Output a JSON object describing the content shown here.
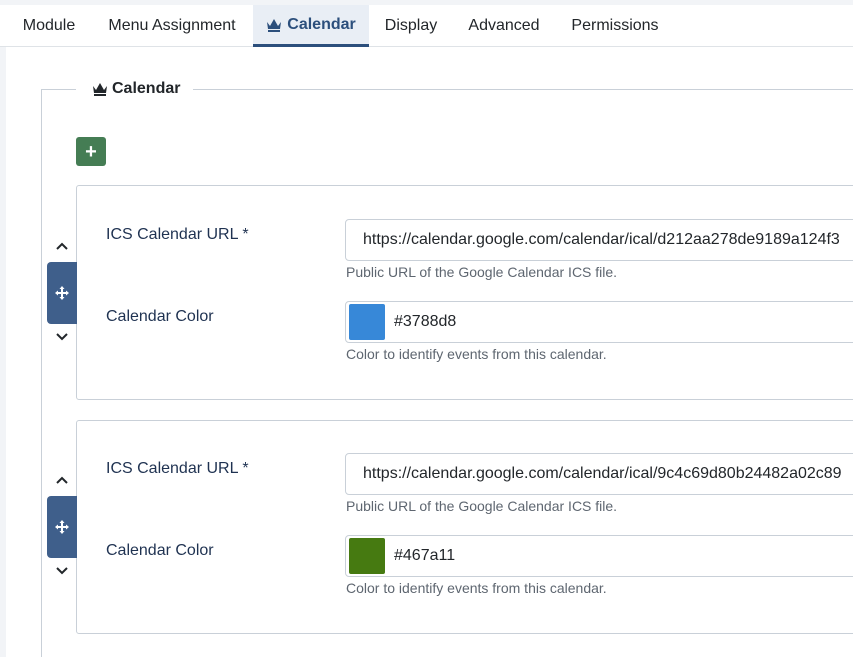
{
  "tabs": [
    {
      "label": "Module"
    },
    {
      "label": "Menu Assignment"
    },
    {
      "label": "Calendar",
      "icon": "crown-icon"
    },
    {
      "label": "Display"
    },
    {
      "label": "Advanced"
    },
    {
      "label": "Permissions"
    }
  ],
  "active_tab": "Calendar",
  "fieldset": {
    "legend": "Calendar",
    "add_label": "+"
  },
  "items": [
    {
      "url_label": "ICS Calendar URL *",
      "url_value": "https://calendar.google.com/calendar/ical/d212aa278de9189a124f3",
      "url_help": "Public URL of the Google Calendar ICS file.",
      "color_label": "Calendar Color",
      "color_value": "#3788d8",
      "color_help": "Color to identify events from this calendar."
    },
    {
      "url_label": "ICS Calendar URL *",
      "url_value": "https://calendar.google.com/calendar/ical/9c4c69d80b24482a02c89",
      "url_help": "Public URL of the Google Calendar ICS file.",
      "color_label": "Calendar Color",
      "color_value": "#467a11",
      "color_help": "Color to identify events from this calendar."
    }
  ],
  "colors": {
    "accent": "#2c4f7c",
    "add_button": "#457d54",
    "move_handle": "#3f5f8b"
  }
}
